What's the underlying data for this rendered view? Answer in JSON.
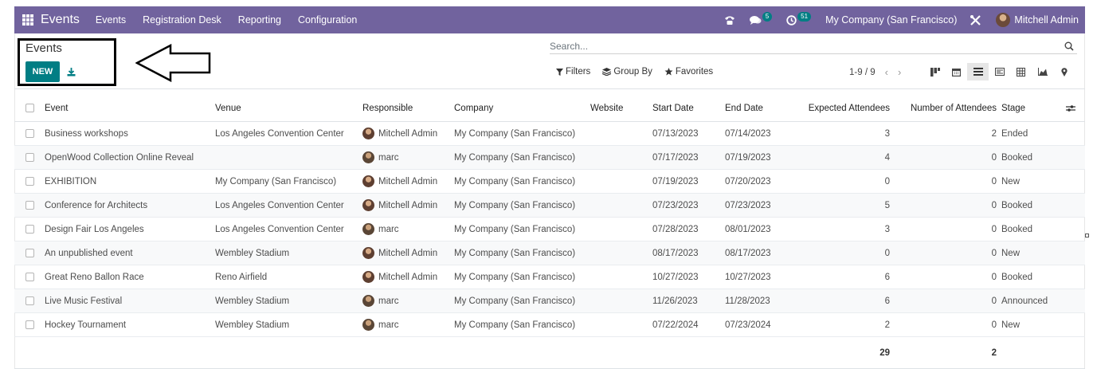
{
  "navbar": {
    "brand": "Events",
    "menu": [
      "Events",
      "Registration Desk",
      "Reporting",
      "Configuration"
    ],
    "messages_badge": "5",
    "activities_badge": "51",
    "company": "My Company (San Francisco)",
    "user": "Mitchell Admin",
    "bg_color": "#71639e"
  },
  "control_panel": {
    "title": "Events",
    "new_label": "NEW",
    "search_placeholder": "Search...",
    "filters_label": "Filters",
    "group_by_label": "Group By",
    "favorites_label": "Favorites",
    "pager": "1-9 / 9",
    "accent_color": "#017e84"
  },
  "table": {
    "columns": [
      "Event",
      "Venue",
      "Responsible",
      "Company",
      "Website",
      "Start Date",
      "End Date",
      "Expected Attendees",
      "Number of Attendees",
      "Stage"
    ],
    "rows": [
      {
        "event": "Business workshops",
        "venue": "Los Angeles Convention Center",
        "responsible": "Mitchell Admin",
        "company": "My Company (San Francisco)",
        "website": "",
        "start": "07/13/2023",
        "end": "07/14/2023",
        "expected": "3",
        "number": "2",
        "stage": "Ended"
      },
      {
        "event": "OpenWood Collection Online Reveal",
        "venue": "",
        "responsible": "marc",
        "company": "My Company (San Francisco)",
        "website": "",
        "start": "07/17/2023",
        "end": "07/19/2023",
        "expected": "4",
        "number": "0",
        "stage": "Booked"
      },
      {
        "event": "EXHIBITION",
        "venue": "My Company (San Francisco)",
        "responsible": "Mitchell Admin",
        "company": "My Company (San Francisco)",
        "website": "",
        "start": "07/19/2023",
        "end": "07/20/2023",
        "expected": "0",
        "number": "0",
        "stage": "New"
      },
      {
        "event": "Conference for Architects",
        "venue": "Los Angeles Convention Center",
        "responsible": "Mitchell Admin",
        "company": "My Company (San Francisco)",
        "website": "",
        "start": "07/23/2023",
        "end": "07/23/2023",
        "expected": "5",
        "number": "0",
        "stage": "Booked"
      },
      {
        "event": "Design Fair Los Angeles",
        "venue": "Los Angeles Convention Center",
        "responsible": "marc",
        "company": "My Company (San Francisco)",
        "website": "",
        "start": "07/28/2023",
        "end": "08/01/2023",
        "expected": "3",
        "number": "0",
        "stage": "Booked"
      },
      {
        "event": "An unpublished event",
        "venue": "Wembley Stadium",
        "responsible": "Mitchell Admin",
        "company": "My Company (San Francisco)",
        "website": "",
        "start": "08/17/2023",
        "end": "08/17/2023",
        "expected": "0",
        "number": "0",
        "stage": "New"
      },
      {
        "event": "Great Reno Ballon Race",
        "venue": "Reno Airfield",
        "responsible": "Mitchell Admin",
        "company": "My Company (San Francisco)",
        "website": "",
        "start": "10/27/2023",
        "end": "10/27/2023",
        "expected": "6",
        "number": "0",
        "stage": "Booked"
      },
      {
        "event": "Live Music Festival",
        "venue": "Wembley Stadium",
        "responsible": "marc",
        "company": "My Company (San Francisco)",
        "website": "",
        "start": "11/26/2023",
        "end": "11/28/2023",
        "expected": "6",
        "number": "0",
        "stage": "Announced"
      },
      {
        "event": "Hockey Tournament",
        "venue": "Wembley Stadium",
        "responsible": "marc",
        "company": "My Company (San Francisco)",
        "website": "",
        "start": "07/22/2024",
        "end": "07/23/2024",
        "expected": "2",
        "number": "0",
        "stage": "New"
      }
    ],
    "totals": {
      "expected": "29",
      "number": "2"
    }
  }
}
